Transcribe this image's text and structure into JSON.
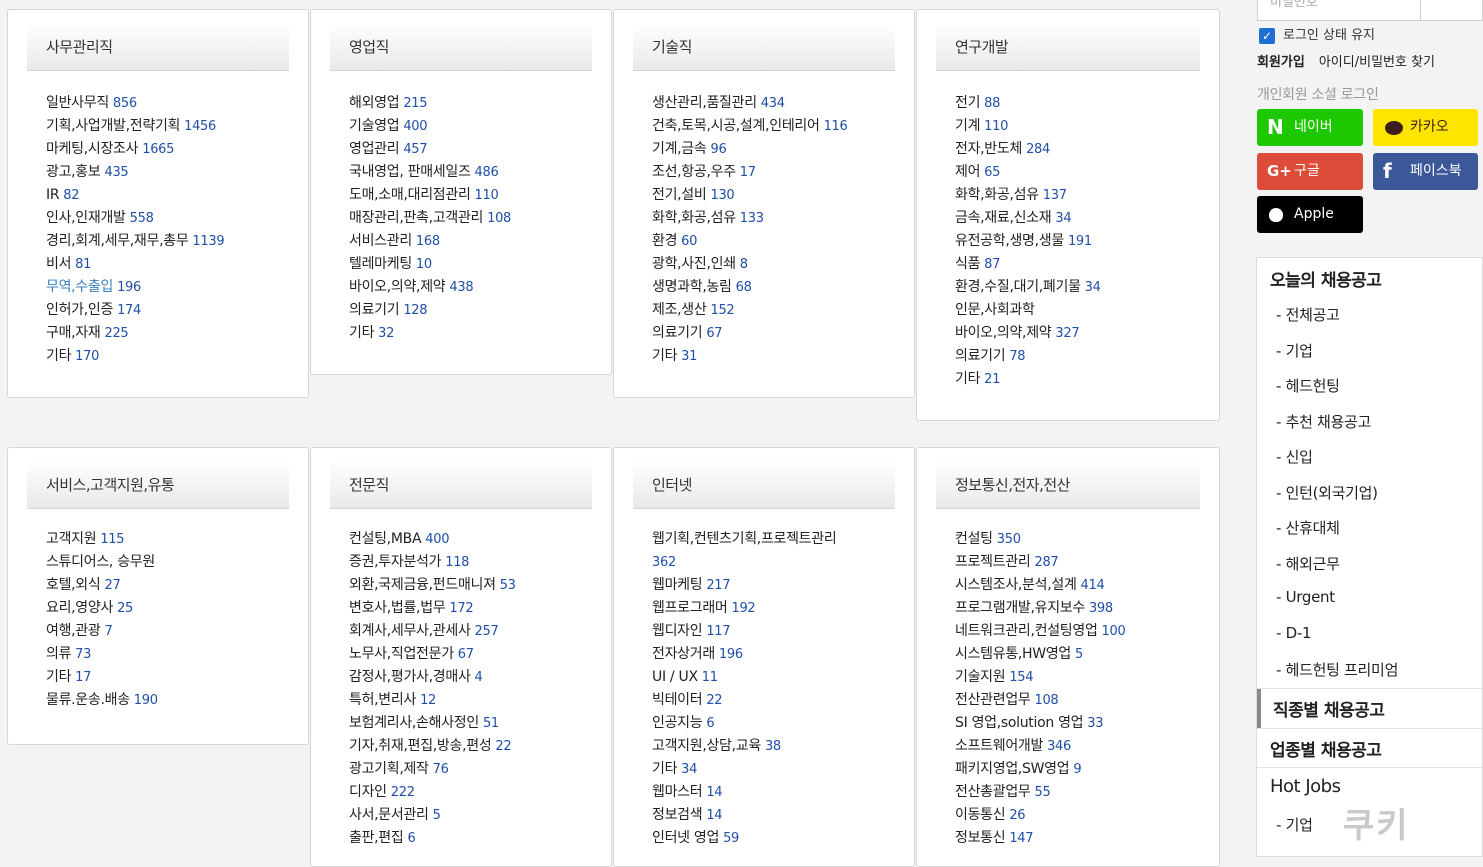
{
  "categories": [
    {
      "title": "사무관리직",
      "items": [
        {
          "name": "일반사무직",
          "count": "856"
        },
        {
          "name": "기획,사업개발,전략기획",
          "count": "1456"
        },
        {
          "name": "마케팅,시장조사",
          "count": "1665"
        },
        {
          "name": "광고,홍보",
          "count": "435"
        },
        {
          "name": "IR",
          "count": "82"
        },
        {
          "name": "인사,인재개발",
          "count": "558"
        },
        {
          "name": "경리,회계,세무,재무,총무",
          "count": "1139"
        },
        {
          "name": "비서",
          "count": "81"
        },
        {
          "name": "무역,수출입",
          "count": "196"
        },
        {
          "name": "인허가,인증",
          "count": "174"
        },
        {
          "name": "구매,자재",
          "count": "225"
        },
        {
          "name": "기타",
          "count": "170"
        }
      ]
    },
    {
      "title": "영업직",
      "items": [
        {
          "name": "해외영업",
          "count": "215"
        },
        {
          "name": "기술영업",
          "count": "400"
        },
        {
          "name": "영업관리",
          "count": "457"
        },
        {
          "name": "국내영업, 판매세일즈",
          "count": "486"
        },
        {
          "name": "도매,소매,대리점관리",
          "count": "110"
        },
        {
          "name": "매장관리,판촉,고객관리",
          "count": "108"
        },
        {
          "name": "서비스관리",
          "count": "168"
        },
        {
          "name": "텔레마케팅",
          "count": "10"
        },
        {
          "name": "바이오,의약,제약",
          "count": "438"
        },
        {
          "name": "의료기기",
          "count": "128"
        },
        {
          "name": "기타",
          "count": "32"
        }
      ]
    },
    {
      "title": "기술직",
      "items": [
        {
          "name": "생산관리,품질관리",
          "count": "434"
        },
        {
          "name": "건축,토목,시공,설계,인테리어",
          "count": "116"
        },
        {
          "name": "기계,금속",
          "count": "96"
        },
        {
          "name": "조선,항공,우주",
          "count": "17"
        },
        {
          "name": "전기,설비",
          "count": "130"
        },
        {
          "name": "화학,화공,섬유",
          "count": "133"
        },
        {
          "name": "환경",
          "count": "60"
        },
        {
          "name": "광학,사진,인쇄",
          "count": "8"
        },
        {
          "name": "생명과학,농림",
          "count": "68"
        },
        {
          "name": "제조,생산",
          "count": "152"
        },
        {
          "name": "의료기기",
          "count": "67"
        },
        {
          "name": "기타",
          "count": "31"
        }
      ]
    },
    {
      "title": "연구개발",
      "items": [
        {
          "name": "전기",
          "count": "88"
        },
        {
          "name": "기계",
          "count": "110"
        },
        {
          "name": "전자,반도체",
          "count": "284"
        },
        {
          "name": "제어",
          "count": "65"
        },
        {
          "name": "화학,화공,섬유",
          "count": "137"
        },
        {
          "name": "금속,재료,신소재",
          "count": "34"
        },
        {
          "name": "유전공학,생명,생물",
          "count": "191"
        },
        {
          "name": "식품",
          "count": "87"
        },
        {
          "name": "환경,수질,대기,폐기물",
          "count": "34"
        },
        {
          "name": "인문,사회과학",
          "count": ""
        },
        {
          "name": "바이오,의약,제약",
          "count": "327"
        },
        {
          "name": "의료기기",
          "count": "78"
        },
        {
          "name": "기타",
          "count": "21"
        }
      ]
    },
    {
      "title": "서비스,고객지원,유통",
      "items": [
        {
          "name": "고객지원",
          "count": "115"
        },
        {
          "name": "스튜디어스, 승무원",
          "count": ""
        },
        {
          "name": "호텔,외식",
          "count": "27"
        },
        {
          "name": "요리,영양사",
          "count": "25"
        },
        {
          "name": "여행,관광",
          "count": "7"
        },
        {
          "name": "의류",
          "count": "73"
        },
        {
          "name": "기타",
          "count": "17"
        },
        {
          "name": "물류.운송.배송",
          "count": "190"
        }
      ]
    },
    {
      "title": "전문직",
      "items": [
        {
          "name": "컨설팅,MBA",
          "count": "400"
        },
        {
          "name": "증권,투자분석가",
          "count": "118"
        },
        {
          "name": "외환,국제금융,펀드매니져",
          "count": "53"
        },
        {
          "name": "변호사,법률,법무",
          "count": "172"
        },
        {
          "name": "회계사,세무사,관세사",
          "count": "257"
        },
        {
          "name": "노무사,직업전문가",
          "count": "67"
        },
        {
          "name": "감정사,평가사,경매사",
          "count": "4"
        },
        {
          "name": "특허,변리사",
          "count": "12"
        },
        {
          "name": "보험계리사,손해사정인",
          "count": "51"
        },
        {
          "name": "기자,취재,편집,방송,편성",
          "count": "22"
        },
        {
          "name": "광고기획,제작",
          "count": "76"
        },
        {
          "name": "디자인",
          "count": "222"
        },
        {
          "name": "사서,문서관리",
          "count": "5"
        },
        {
          "name": "출판,편집",
          "count": "6"
        }
      ]
    },
    {
      "title": "인터넷",
      "items": [
        {
          "name": "웹기획,컨텐츠기획,프로젝트관리",
          "count": "362"
        },
        {
          "name": "웹마케팅",
          "count": "217"
        },
        {
          "name": "웹프로그래머",
          "count": "192"
        },
        {
          "name": "웹디자인",
          "count": "117"
        },
        {
          "name": "전자상거래",
          "count": "196"
        },
        {
          "name": "UI / UX",
          "count": "11"
        },
        {
          "name": "빅테이터",
          "count": "22"
        },
        {
          "name": "인공지능",
          "count": "6"
        },
        {
          "name": "고객지원,상담,교육",
          "count": "38"
        },
        {
          "name": "기타",
          "count": "34"
        },
        {
          "name": "웹마스터",
          "count": "14"
        },
        {
          "name": "정보검색",
          "count": "14"
        },
        {
          "name": "인터넷 영업",
          "count": "59"
        }
      ]
    },
    {
      "title": "정보통신,전자,전산",
      "items": [
        {
          "name": "컨설팅",
          "count": "350"
        },
        {
          "name": "프로젝트관리",
          "count": "287"
        },
        {
          "name": "시스템조사,분석,설계",
          "count": "414"
        },
        {
          "name": "프로그램개발,유지보수",
          "count": "398"
        },
        {
          "name": "네트워크관리,컨설팅영업",
          "count": "100"
        },
        {
          "name": "시스템유통,HW영업",
          "count": "5"
        },
        {
          "name": "기술지원",
          "count": "154"
        },
        {
          "name": "전산관련업무",
          "count": "108"
        },
        {
          "name": "SI 영업,solution 영업",
          "count": "33"
        },
        {
          "name": "소프트웨어개발",
          "count": "346"
        },
        {
          "name": "패키지영업,SW영업",
          "count": "9"
        },
        {
          "name": "전산총괄업무",
          "count": "55"
        },
        {
          "name": "이동통신",
          "count": "26"
        },
        {
          "name": "정보통신",
          "count": "147"
        }
      ]
    }
  ],
  "sidebar": {
    "password_placeholder": "비밀번호",
    "keep_login": "로그인 상태 유지",
    "join": "회원가입",
    "find": "아이디/비밀번호 찾기",
    "social_title": "개인회원 소셜 로그인",
    "social": {
      "naver": "네이버",
      "kakao": "카카오",
      "google": "구글",
      "facebook": "페이스북",
      "apple": "Apple"
    },
    "today_title": "오늘의 채용공고",
    "today_items": [
      "전체공고",
      "기업",
      "헤드헌팅",
      "추천 채용공고",
      "신입",
      "인턴(외국기업)",
      "산휴대체",
      "해외근무",
      "Urgent",
      "D-1",
      "헤드헌팅 프리미엄"
    ],
    "job_type_title": "직종별 채용공고",
    "industry_title": "업종별 채용공고",
    "hot_jobs_title": "Hot Jobs",
    "hot_items": [
      "기업"
    ],
    "mascot_text": "쿠키"
  },
  "colors": {
    "count": "#1f4fa8",
    "highlight": "#3b7fc4",
    "naver": "#1ec800",
    "kakao": "#fee500",
    "google": "#dd4b39",
    "facebook": "#3b5998",
    "apple": "#000000"
  }
}
